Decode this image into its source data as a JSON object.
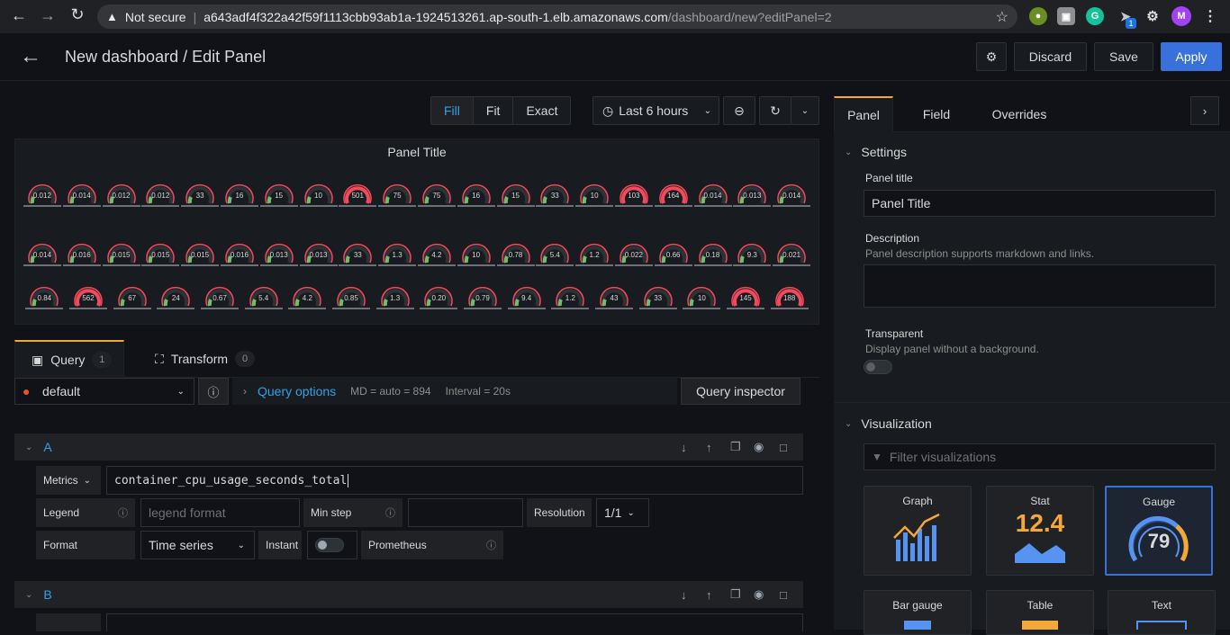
{
  "browser": {
    "security": "Not secure",
    "host": "a643adf4f322a42f59f1113cbb93ab1a-1924513261.ap-south-1.elb.amazonaws.com",
    "path": "/dashboard/new?editPanel=2",
    "profile_initial": "M",
    "ext_badge": "1"
  },
  "header": {
    "title": "New dashboard / Edit Panel",
    "discard_label": "Discard",
    "save_label": "Save",
    "apply_label": "Apply"
  },
  "viewmode": {
    "fill": "Fill",
    "fit": "Fit",
    "exact": "Exact"
  },
  "timepicker": {
    "label": "Last 6 hours"
  },
  "panel": {
    "title": "Panel Title",
    "gauges": [
      [
        "0.012",
        "0.014",
        "0.012",
        "0.012",
        "33",
        "16",
        "15",
        "10",
        "501",
        "75",
        "75",
        "16",
        "15",
        "33",
        "10",
        "103",
        "164",
        "0.014",
        "0.013",
        "0.014"
      ],
      [
        "0.014",
        "0.016",
        "0.015",
        "0.015",
        "0.015",
        "0.016",
        "0.013",
        "0.013",
        "33",
        "1.3",
        "4.2",
        "10",
        "0.78",
        "5.4",
        "1.2",
        "0.022",
        "0.66",
        "0.18",
        "9.3",
        "0.021"
      ],
      [
        "0.84",
        "562",
        "67",
        "24",
        "0.67",
        "5.4",
        "4.2",
        "0.85",
        "1.3",
        "0.20",
        "0.79",
        "9.4",
        "1.2",
        "43",
        "33",
        "10",
        "145",
        "188"
      ]
    ],
    "colors": {
      "threshold_red": "#f2495c",
      "ok_green": "#73bf69",
      "track": "#2c3235"
    }
  },
  "query_tabs": {
    "query_label": "Query",
    "query_count": "1",
    "transform_label": "Transform",
    "transform_count": "0"
  },
  "query": {
    "datasource": "default",
    "options_label": "Query options",
    "md": "MD = auto = 894",
    "interval": "Interval = 20s",
    "inspector_label": "Query inspector",
    "a": {
      "ref": "A",
      "metrics_label": "Metrics",
      "metrics_value": "container_cpu_usage_seconds_total",
      "legend_label": "Legend",
      "legend_placeholder": "legend format",
      "minstep_label": "Min step",
      "resolution_label": "Resolution",
      "resolution_value": "1/1",
      "format_label": "Format",
      "format_value": "Time series",
      "instant_label": "Instant",
      "prometheus_label": "Prometheus"
    },
    "b": {
      "ref": "B"
    }
  },
  "options": {
    "tabs": {
      "panel": "Panel",
      "field": "Field",
      "overrides": "Overrides"
    },
    "settings": {
      "heading": "Settings",
      "title_label": "Panel title",
      "title_value": "Panel Title",
      "desc_label": "Description",
      "desc_help": "Panel description supports markdown and links.",
      "transparent_label": "Transparent",
      "transparent_help": "Display panel without a background."
    },
    "visualization": {
      "heading": "Visualization",
      "filter_placeholder": "Filter visualizations",
      "cards": [
        {
          "name": "Graph"
        },
        {
          "name": "Stat",
          "value": "12.4"
        },
        {
          "name": "Gauge",
          "value": "79"
        },
        {
          "name": "Bar gauge"
        },
        {
          "name": "Table"
        },
        {
          "name": "Text"
        }
      ]
    }
  }
}
